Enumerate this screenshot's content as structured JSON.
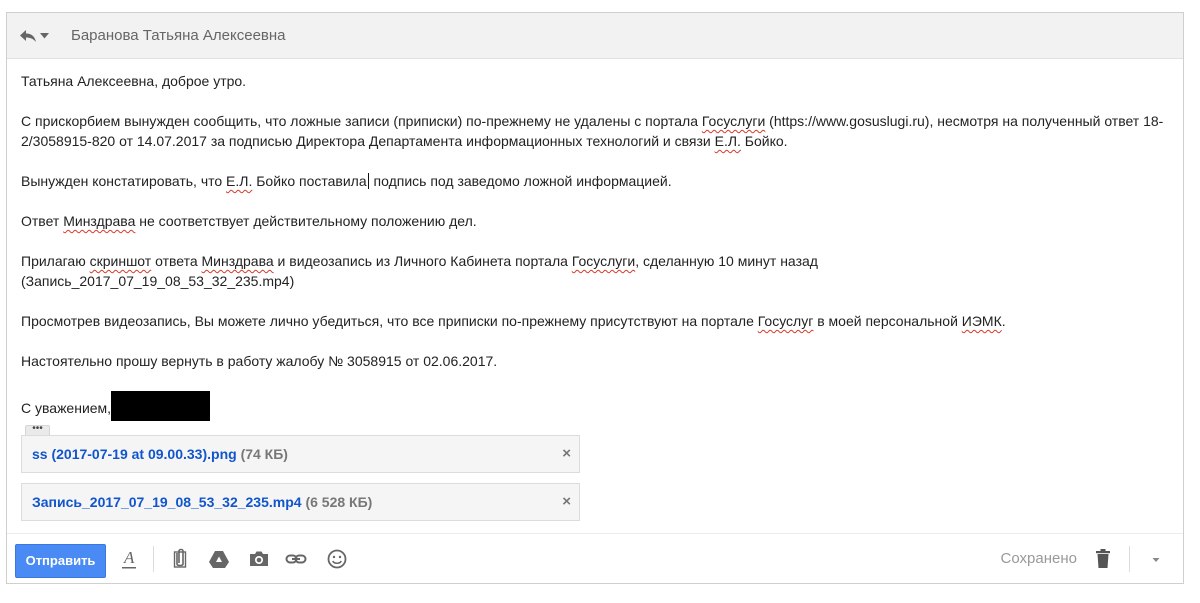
{
  "header": {
    "recipient": "Баранова Татьяна Алексеевна"
  },
  "message": {
    "greeting": "Татьяна Алексеевна, доброе утро.",
    "p1_a": "С прискорбием вынужден сообщить, что ложные записи (приписки) по-прежнему не удалены с портала ",
    "p1_gos": "Госуслуги",
    "p1_b": " (https://www.gosuslugi.ru), несмотря на полученный ответ 18-2/3058915-820 от 14.07.2017 за подписью Директора Департамента информационных технологий и связи ",
    "p1_el": "Е.Л.",
    "p1_c": " Бойко.",
    "p2_a": "Вынужден констатировать, что ",
    "p2_el": "Е.Л.",
    "p2_b": " Бойко поставила",
    "p2_c": " подпись под заведомо ложной информацией.",
    "p3_a": "Ответ ",
    "p3_mz": "Минздрава",
    "p3_b": " не соответствует действительному положению дел.",
    "p4_a": "Прилагаю ",
    "p4_ss": "скриншот",
    "p4_b": " ответа ",
    "p4_mz": "Минздрава",
    "p4_c": " и видеозапись из Личного Кабинета портала ",
    "p4_gos": "Госуслуги",
    "p4_d": ", сделанную 10 минут назад",
    "p4_e": "(Запись_2017_07_19_08_53_32_235.mp4)",
    "p5_a": "Просмотрев видеозапись, Вы можете лично убедиться, что все приписки по-прежнему присутствуют на портале ",
    "p5_gos": "Госуслуг",
    "p5_b": " в моей персональной ",
    "p5_iemk": "ИЭМК",
    "p5_c": ".",
    "p6": "Настоятельно прошу вернуть в работу жалобу  № 3058915 от 02.06.2017.",
    "signoff": "С уважением,"
  },
  "more_label": "•••",
  "attachments": [
    {
      "name": "ss (2017-07-19 at 09.00.33).png",
      "size": "(74 КБ)"
    },
    {
      "name": "Запись_2017_07_19_08_53_32_235.mp4",
      "size": "(6 528 КБ)"
    }
  ],
  "toolbar": {
    "send_label": "Отправить",
    "saved_label": "Сохранено",
    "icons": [
      "format-text-icon",
      "attach-icon",
      "drive-icon",
      "photo-icon",
      "link-icon",
      "emoji-icon",
      "trash-icon",
      "more-options-icon"
    ]
  },
  "colors": {
    "send_button": "#4a8af4",
    "attachment_link": "#1155cc",
    "spellcheck_underline": "#d23a2a"
  }
}
